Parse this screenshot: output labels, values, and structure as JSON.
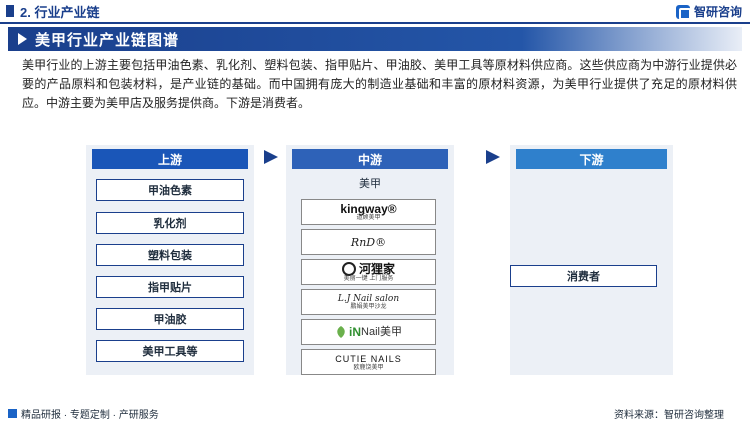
{
  "header": {
    "section_title": "2. 行业产业链",
    "brand": "智研咨询"
  },
  "banner": {
    "title": "美甲行业产业链图谱"
  },
  "intro": "美甲行业的上游主要包括甲油色素、乳化剂、塑料包装、指甲贴片、甲油胶、美甲工具等原材料供应商。这些供应商为中游行业提供必要的产品原料和包装材料，是产业链的基础。而中国拥有庞大的制造业基础和丰富的原材料资源，为美甲行业提供了充足的原材料供应。中游主要为美甲店及服务提供商。下游是消费者。",
  "upstream": {
    "title": "上游",
    "items": [
      "甲油色素",
      "乳化剂",
      "塑料包装",
      "指甲贴片",
      "甲油胶",
      "美甲工具等"
    ]
  },
  "midstream": {
    "title": "中游",
    "label": "美甲",
    "logos": [
      {
        "main": "kingway®",
        "sub": "道顾美甲"
      },
      {
        "main": "RnD®",
        "sub": ""
      },
      {
        "main": "河狸家",
        "sub": "美丽一键 上门服务"
      },
      {
        "main": "L.J Nail salon",
        "sub": "鹏娟美甲沙龙"
      },
      {
        "main": "iN",
        "main2": "Nail美甲",
        "sub": ""
      },
      {
        "main": "CUTIE NAILS",
        "sub": "欧鹿饶美甲"
      }
    ]
  },
  "downstream": {
    "title": "下游",
    "items": [
      "消费者"
    ]
  },
  "footer": {
    "left": "精品研报 · 专题定制 · 产研服务",
    "right": "资料来源：智研咨询整理"
  },
  "colors": {
    "primary": "#1a3f8c",
    "accent": "#1a56b8",
    "panel_bg": "#ecf0f6"
  }
}
